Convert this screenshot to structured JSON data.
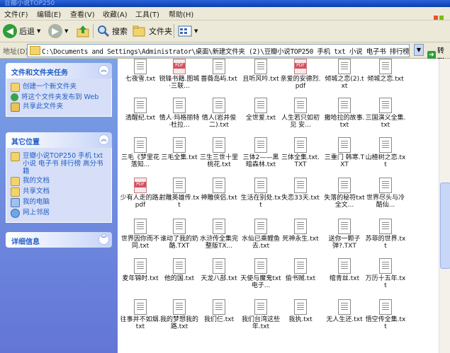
{
  "window": {
    "title": "豆瓣小说TOP250"
  },
  "menu": [
    "文件(F)",
    "编辑(E)",
    "查看(V)",
    "收藏(A)",
    "工具(T)",
    "帮助(H)"
  ],
  "toolbar": {
    "back": "后退",
    "search": "搜索",
    "folders": "文件夹"
  },
  "address": {
    "label": "地址(D)",
    "path": "C:\\Documents and Settings\\Administrator\\桌面\\新建文件夹 (2)\\豆瓣小说TOP250 手机 txt 小说 电子书 排行榜 高分",
    "go": "转到"
  },
  "tasks": {
    "title": "文件和文件夹任务",
    "items": [
      "创建一个新文件夹",
      "将这个文件夹发布到 Web",
      "共享此文件夹"
    ]
  },
  "places": {
    "title": "其它位置",
    "items": [
      "豆瓣小说TOP250 手机 txt 小说 电子书 排行榜 高分书籍",
      "我的文档",
      "共享文档",
      "我的电脑",
      "网上邻居"
    ]
  },
  "details": {
    "title": "详细信息"
  },
  "files": [
    {
      "name": "七夜雪.txt",
      "type": "txt"
    },
    {
      "name": "锐锋书籍.图城·三联...",
      "type": "pdf"
    },
    {
      "name": "蔷薇岛屿.txt",
      "type": "txt"
    },
    {
      "name": "且听风吟.txt",
      "type": "txt"
    },
    {
      "name": "亲爱的安德烈.pdf",
      "type": "pdf"
    },
    {
      "name": "倾城之恋(2).txt",
      "type": "txt"
    },
    {
      "name": "倾城之恋.txt",
      "type": "txt"
    },
    {
      "name": "清醒纪.txt",
      "type": "txt"
    },
    {
      "name": "情人·玛格丽特·杜拉...",
      "type": "txt"
    },
    {
      "name": "情人(岩井俊二).txt",
      "type": "txt"
    },
    {
      "name": "全世爱.txt",
      "type": "txt"
    },
    {
      "name": "人生若只如初见 安...",
      "type": "txt"
    },
    {
      "name": "撒哈拉的故事.txt",
      "type": "txt"
    },
    {
      "name": "三国演义全集.txt",
      "type": "txt"
    },
    {
      "name": "三毛《梦里花落知...",
      "type": "txt"
    },
    {
      "name": "三毛全集.txt",
      "type": "txt"
    },
    {
      "name": "三生三世十里桃花.txt",
      "type": "txt"
    },
    {
      "name": "三体2——黑暗森林.txt",
      "type": "txt"
    },
    {
      "name": "三体全集.txt.TXT",
      "type": "txt"
    },
    {
      "name": "三重门 韩寒.TXT",
      "type": "txt"
    },
    {
      "name": "山楂树之恋.txt",
      "type": "txt"
    },
    {
      "name": "少有人走的路.pdf",
      "type": "pdf"
    },
    {
      "name": "射雕英雄传.txt",
      "type": "txt"
    },
    {
      "name": "神雕侠侣.txt",
      "type": "txt"
    },
    {
      "name": "生活在别处.txt",
      "type": "txt"
    },
    {
      "name": "失恋33天.txt",
      "type": "txt"
    },
    {
      "name": "失落的秘符txt全文...",
      "type": "txt"
    },
    {
      "name": "世界尽头与冷酷仙...",
      "type": "txt"
    },
    {
      "name": "世界因你而不同.txt",
      "type": "txt"
    },
    {
      "name": "谁动了我的奶酪.TXT",
      "type": "txt"
    },
    {
      "name": "水浒传全集完整版TX...",
      "type": "txt"
    },
    {
      "name": "水仙已乘鲤鱼去.txt",
      "type": "txt"
    },
    {
      "name": "死神永生.txt",
      "type": "txt"
    },
    {
      "name": "送你一颗子弹?.TXT",
      "type": "txt"
    },
    {
      "name": "苏菲的世界.txt",
      "type": "txt"
    },
    {
      "name": "麦年锦时.txt",
      "type": "txt"
    },
    {
      "name": "他的国.txt",
      "type": "txt"
    },
    {
      "name": "天龙八部.txt",
      "type": "txt"
    },
    {
      "name": "天使与魔鬼txt电子...",
      "type": "txt"
    },
    {
      "name": "偷书贼.txt",
      "type": "txt"
    },
    {
      "name": "绾青丝.txt",
      "type": "txt"
    },
    {
      "name": "万历十五年.txt",
      "type": "txt"
    },
    {
      "name": "往事并不如烟.txt",
      "type": "txt"
    },
    {
      "name": "我的梦想我的路.txt",
      "type": "txt"
    },
    {
      "name": "我们仨.txt",
      "type": "txt"
    },
    {
      "name": "我们台湾这些年.txt",
      "type": "txt"
    },
    {
      "name": "我执.txt",
      "type": "txt"
    },
    {
      "name": "无人生还.txt",
      "type": "txt"
    },
    {
      "name": "悟空传全集.txt",
      "type": "txt"
    }
  ]
}
